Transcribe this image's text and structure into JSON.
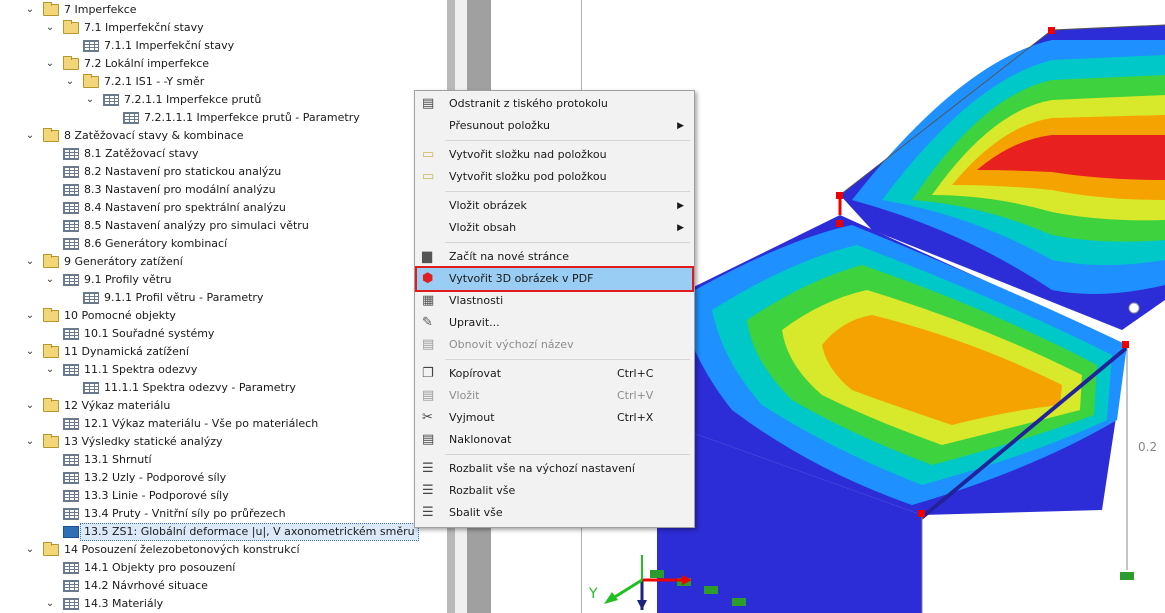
{
  "tree": [
    {
      "label": "7 Imperfekce",
      "level": 0,
      "icon": "folder",
      "expanded": true
    },
    {
      "label": "7.1 Imperfekční stavy",
      "level": 1,
      "icon": "folder",
      "expanded": true
    },
    {
      "label": "7.1.1 Imperfekční stavy",
      "level": 2,
      "icon": "table"
    },
    {
      "label": "7.2 Lokální imperfekce",
      "level": 1,
      "icon": "folder",
      "expanded": true
    },
    {
      "label": "7.2.1 IS1 - -Y směr",
      "level": 2,
      "icon": "folder",
      "expanded": true
    },
    {
      "label": "7.2.1.1 Imperfekce prutů",
      "level": 3,
      "icon": "table",
      "expanded": true
    },
    {
      "label": "7.2.1.1.1 Imperfekce prutů - Parametry",
      "level": 4,
      "icon": "table"
    },
    {
      "label": "8 Zatěžovací stavy & kombinace",
      "level": 0,
      "icon": "folder",
      "expanded": true
    },
    {
      "label": "8.1 Zatěžovací stavy",
      "level": 1,
      "icon": "table"
    },
    {
      "label": "8.2 Nastavení pro statickou analýzu",
      "level": 1,
      "icon": "table"
    },
    {
      "label": "8.3 Nastavení pro modální analýzu",
      "level": 1,
      "icon": "table"
    },
    {
      "label": "8.4 Nastavení pro spektrální analýzu",
      "level": 1,
      "icon": "table"
    },
    {
      "label": "8.5 Nastavení analýzy pro simulaci větru",
      "level": 1,
      "icon": "table"
    },
    {
      "label": "8.6 Generátory kombinací",
      "level": 1,
      "icon": "table"
    },
    {
      "label": "9 Generátory zatížení",
      "level": 0,
      "icon": "folder",
      "expanded": true
    },
    {
      "label": "9.1 Profily větru",
      "level": 1,
      "icon": "table",
      "expanded": true
    },
    {
      "label": "9.1.1 Profil větru - Parametry",
      "level": 2,
      "icon": "table"
    },
    {
      "label": "10 Pomocné objekty",
      "level": 0,
      "icon": "folder",
      "expanded": true
    },
    {
      "label": "10.1 Souřadné systémy",
      "level": 1,
      "icon": "table"
    },
    {
      "label": "11 Dynamická zatížení",
      "level": 0,
      "icon": "folder",
      "expanded": true
    },
    {
      "label": "11.1 Spektra odezvy",
      "level": 1,
      "icon": "table",
      "expanded": true
    },
    {
      "label": "11.1.1 Spektra odezvy - Parametry",
      "level": 2,
      "icon": "table"
    },
    {
      "label": "12 Výkaz materiálu",
      "level": 0,
      "icon": "folder",
      "expanded": true
    },
    {
      "label": "12.1 Výkaz materiálu - Vše po materiálech",
      "level": 1,
      "icon": "table"
    },
    {
      "label": "13 Výsledky statické analýzy",
      "level": 0,
      "icon": "folder",
      "expanded": true
    },
    {
      "label": "13.1 Shrnutí",
      "level": 1,
      "icon": "table"
    },
    {
      "label": "13.2 Uzly - Podporové síly",
      "level": 1,
      "icon": "table"
    },
    {
      "label": "13.3 Linie - Podporové síly",
      "level": 1,
      "icon": "table"
    },
    {
      "label": "13.4 Pruty - Vnitřní síly po průřezech",
      "level": 1,
      "icon": "table"
    },
    {
      "label": "13.5 ZS1: Globální deformace |u|, V axonometrickém směru",
      "level": 1,
      "icon": "image",
      "selected": true
    },
    {
      "label": "14 Posouzení železobetonových konstrukcí",
      "level": 0,
      "icon": "folder",
      "expanded": true
    },
    {
      "label": "14.1 Objekty pro posouzení",
      "level": 1,
      "icon": "table"
    },
    {
      "label": "14.2 Návrhové situace",
      "level": 1,
      "icon": "table"
    },
    {
      "label": "14.3 Materiály",
      "level": 1,
      "icon": "table",
      "expanded": true
    }
  ],
  "menu": [
    {
      "type": "item",
      "label": "Odstranit z tiského protokolu",
      "icon": "delete-from-report-icon"
    },
    {
      "type": "item",
      "label": "Přesunout položku",
      "submenu": true
    },
    {
      "type": "sep"
    },
    {
      "type": "item",
      "label": "Vytvořit složku nad položkou",
      "icon": "folder-above-icon"
    },
    {
      "type": "item",
      "label": "Vytvořit složku pod položkou",
      "icon": "folder-below-icon"
    },
    {
      "type": "sep"
    },
    {
      "type": "item",
      "label": "Vložit obrázek",
      "submenu": true
    },
    {
      "type": "item",
      "label": "Vložit obsah",
      "submenu": true
    },
    {
      "type": "sep"
    },
    {
      "type": "item",
      "label": "Začít na nové stránce",
      "icon": "new-page-icon"
    },
    {
      "type": "item",
      "label": "Vytvořit 3D obrázek v PDF",
      "icon": "3d-cube-icon",
      "highlighted": true
    },
    {
      "type": "item",
      "label": "Vlastnosti",
      "icon": "properties-icon"
    },
    {
      "type": "item",
      "label": "Upravit...",
      "icon": "edit-icon"
    },
    {
      "type": "item",
      "label": "Obnovit výchozí název",
      "icon": "reset-name-icon",
      "disabled": true
    },
    {
      "type": "sep"
    },
    {
      "type": "item",
      "label": "Kopírovat",
      "shortcut": "Ctrl+C",
      "icon": "copy-icon"
    },
    {
      "type": "item",
      "label": "Vložit",
      "shortcut": "Ctrl+V",
      "icon": "paste-icon",
      "disabled": true
    },
    {
      "type": "item",
      "label": "Vyjmout",
      "shortcut": "Ctrl+X",
      "icon": "cut-icon"
    },
    {
      "type": "item",
      "label": "Naklonovat",
      "icon": "clone-icon"
    },
    {
      "type": "sep"
    },
    {
      "type": "item",
      "label": "Rozbalit vše na výchozí nastavení",
      "icon": "expand-default-icon"
    },
    {
      "type": "item",
      "label": "Rozbalit vše",
      "icon": "expand-all-icon"
    },
    {
      "type": "item",
      "label": "Sbalit vše",
      "icon": "collapse-all-icon"
    }
  ],
  "viewport": {
    "axis_label_y": "Y",
    "value_label": "0.2"
  },
  "colors": {
    "highlight": "#99cdf3",
    "highlight_border": "#e01b1b",
    "selection": "#dbe9f8"
  }
}
